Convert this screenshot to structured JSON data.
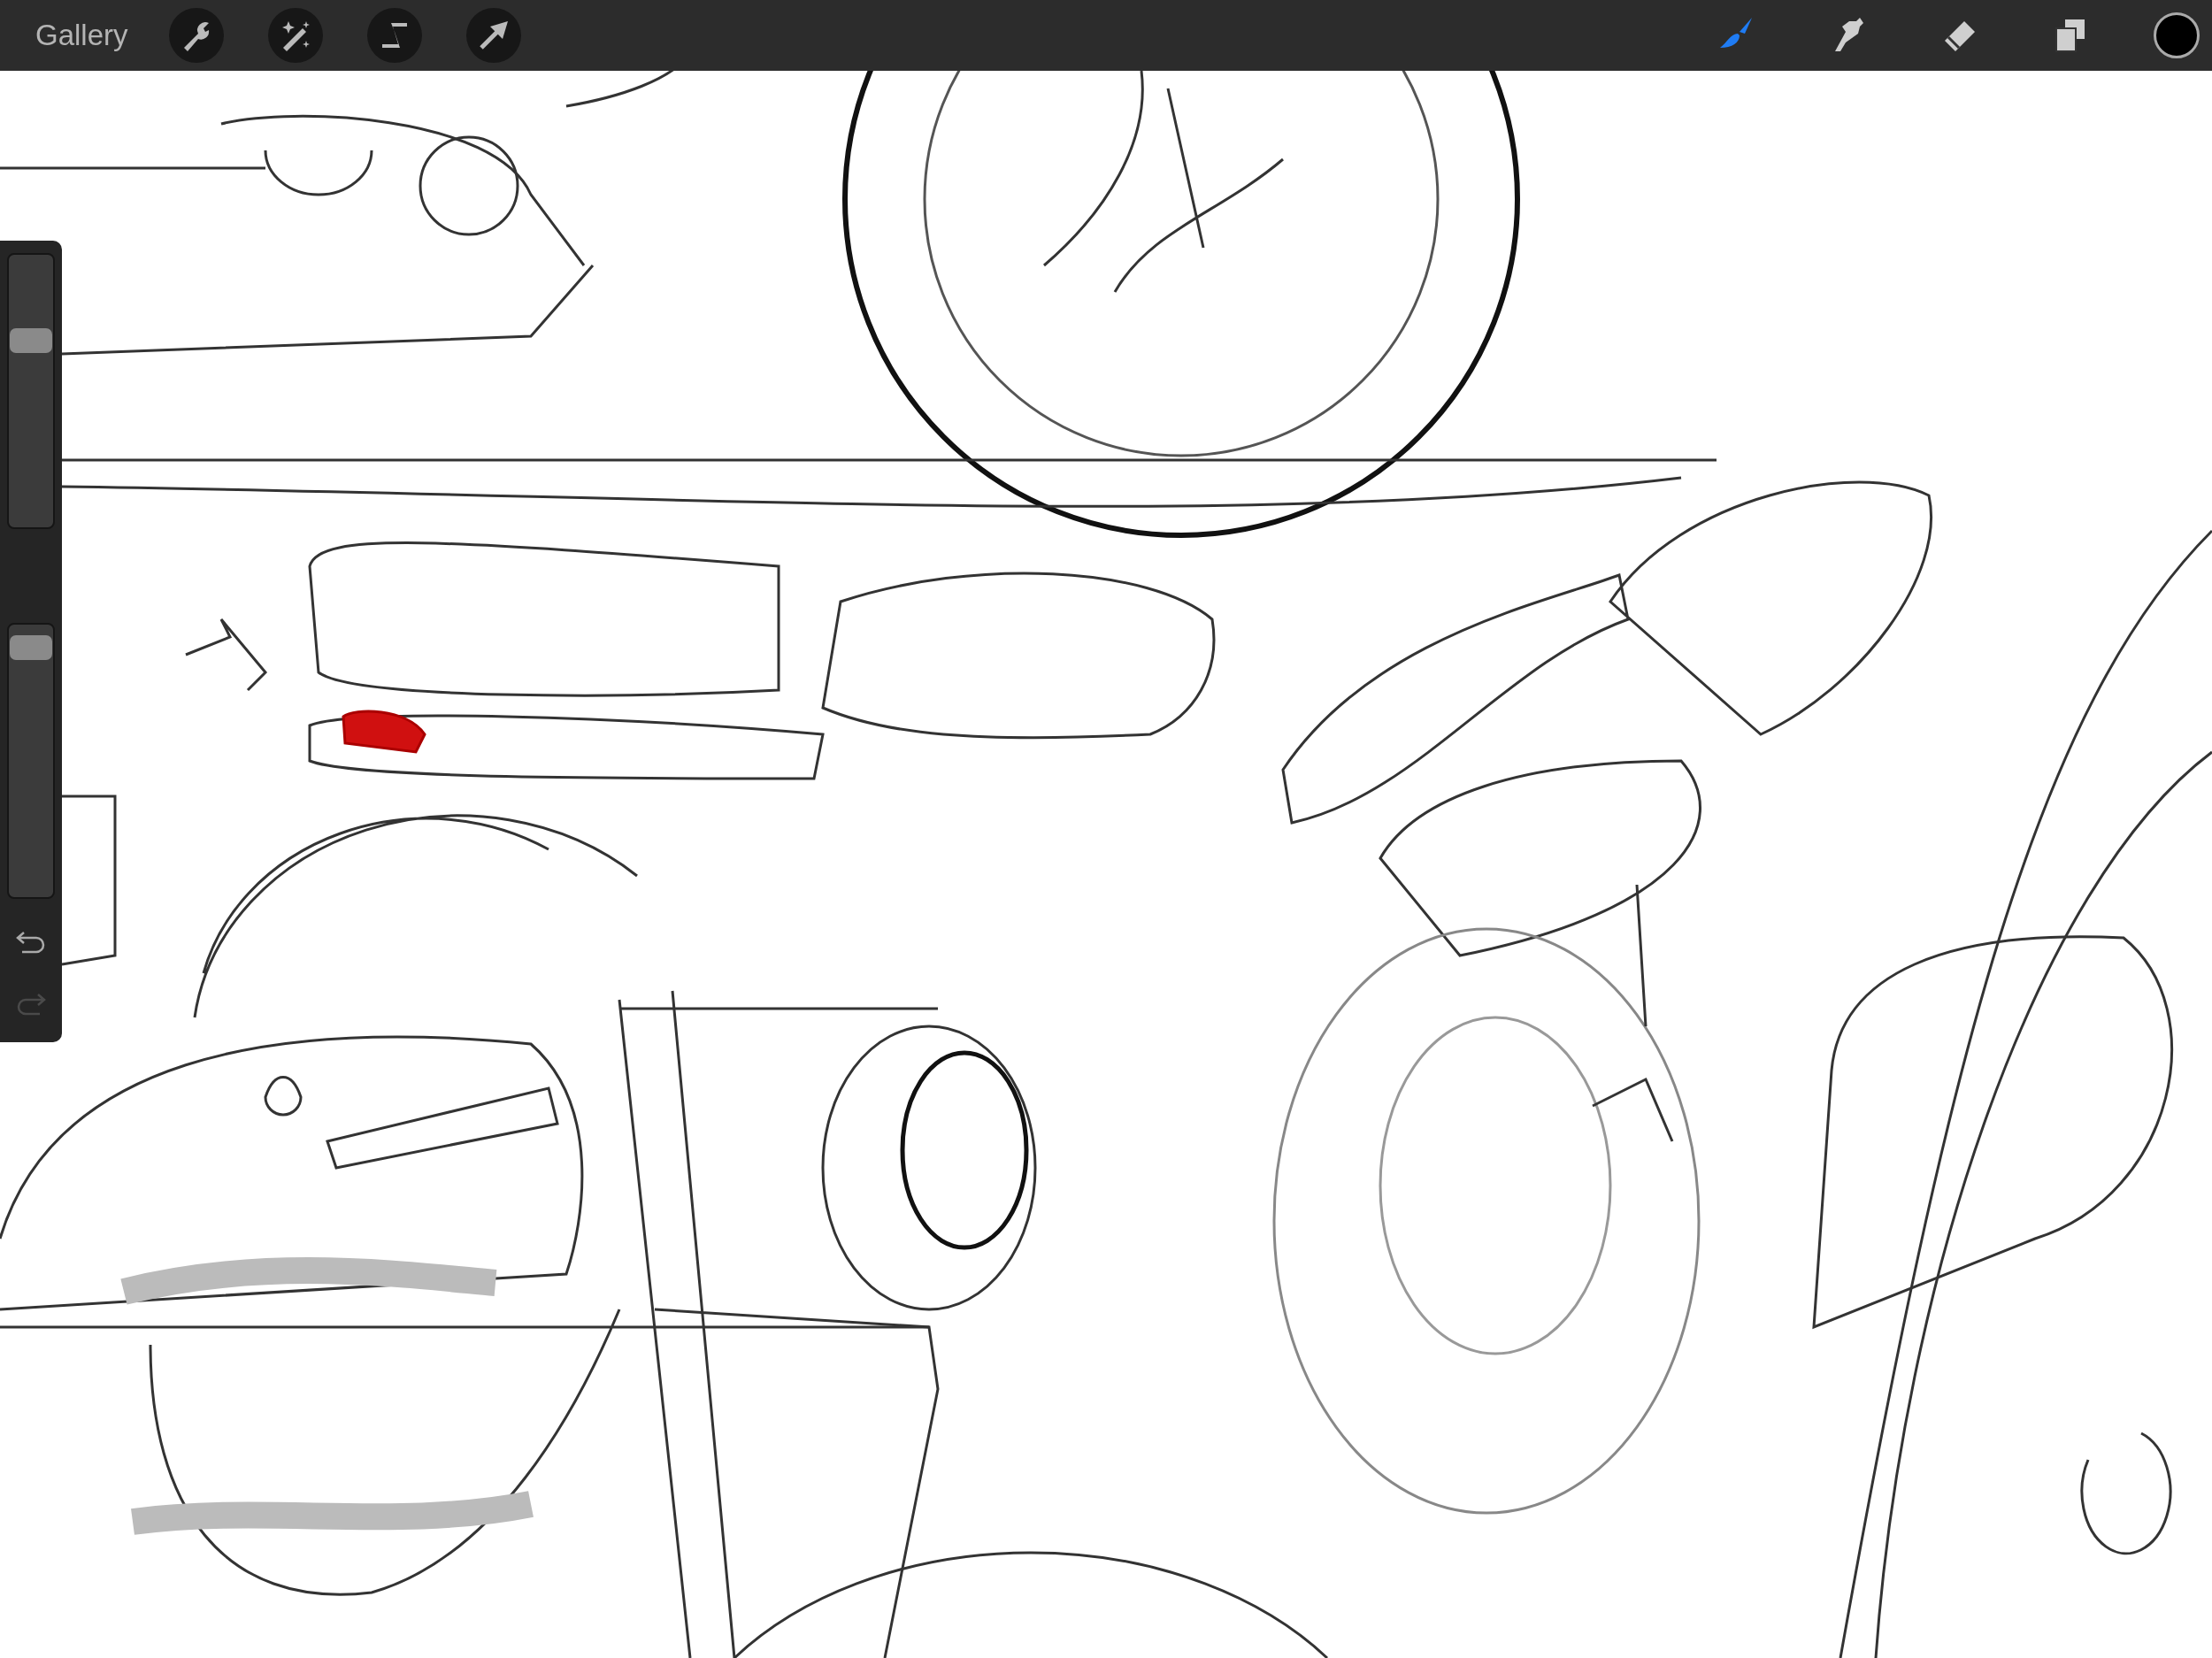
{
  "top_bar": {
    "gallery": "Gallery",
    "actions": [
      {
        "kind": "wrench"
      },
      {
        "kind": "wand"
      },
      {
        "kind": "selection"
      },
      {
        "kind": "transform"
      }
    ],
    "tools": [
      {
        "kind": "brush",
        "selected": true
      },
      {
        "kind": "smudge",
        "selected": false
      },
      {
        "kind": "eraser",
        "selected": false
      },
      {
        "kind": "layers",
        "selected": false
      }
    ],
    "current_color": {
      "color": "#000000"
    }
  },
  "side_bar": {
    "sliders": [
      {
        "level": 0.7
      },
      {
        "level": 0.95
      }
    ],
    "undo": {
      "disabled": false
    },
    "redo": {
      "disabled": true
    }
  }
}
